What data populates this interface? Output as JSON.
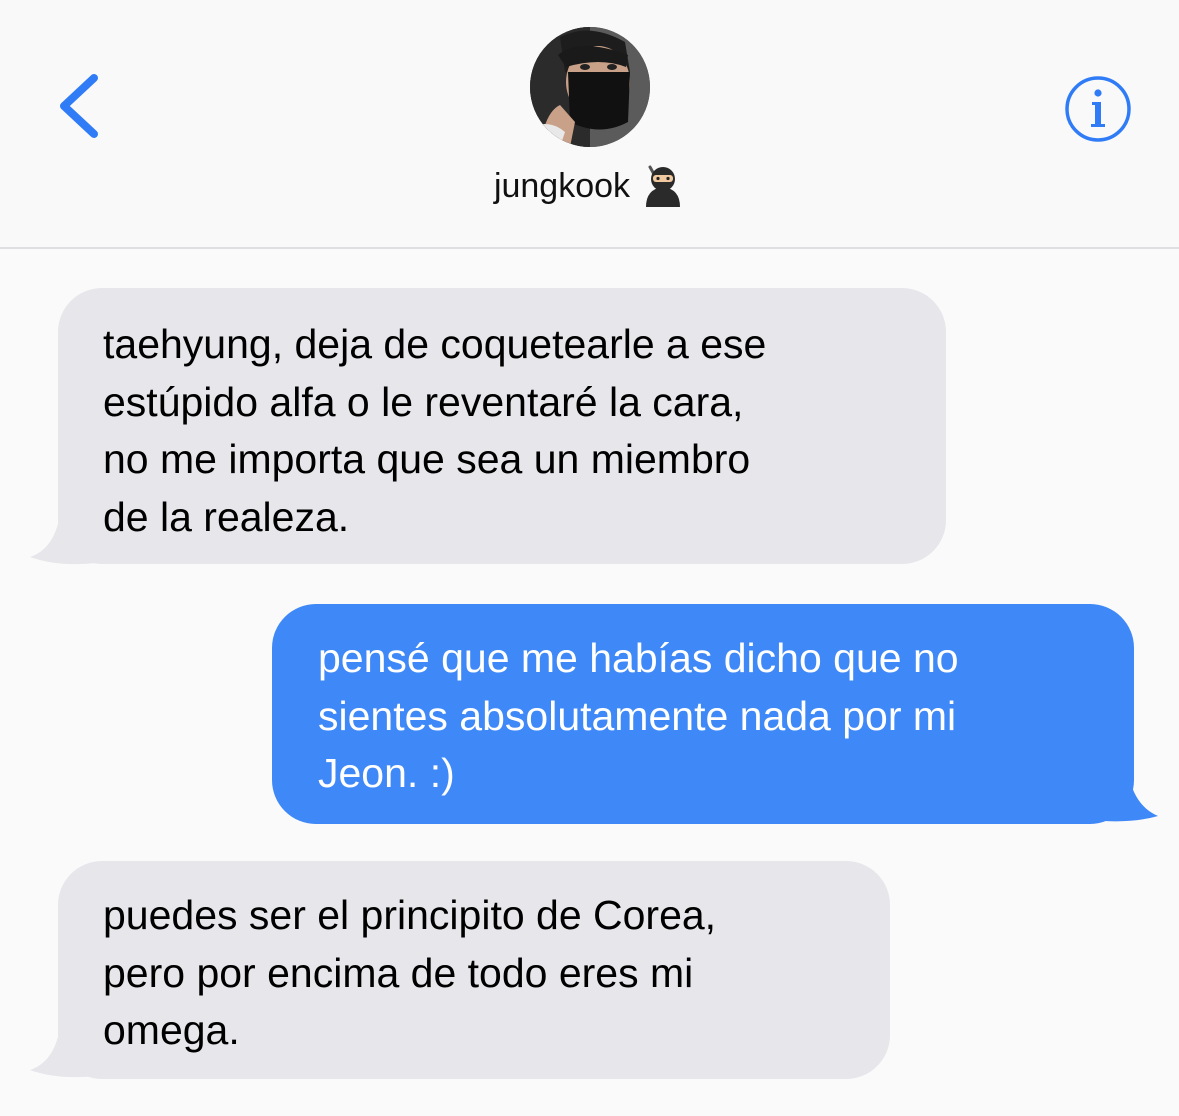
{
  "header": {
    "contact_name": "jungkook",
    "contact_emoji": "🥷",
    "accent_color": "#2f7cf6",
    "back_icon": "chevron-left-icon",
    "info_icon": "info-circle-icon"
  },
  "messages": [
    {
      "direction": "received",
      "text": "taehyung, deja de coquetearle a ese\nestúpido alfa o le reventaré la cara,\nno me importa que sea un miembro\nde la realeza."
    },
    {
      "direction": "sent",
      "text": "pensé que me habías dicho que no\nsientes absolutamente nada por mi\nJeon. :)"
    },
    {
      "direction": "received",
      "text": "puedes ser el principito de Corea,\npero por encima de todo eres mi\nomega."
    }
  ],
  "colors": {
    "received_bubble": "#e6e6eb",
    "sent_bubble": "#3f88f7",
    "background": "#fafafa"
  }
}
